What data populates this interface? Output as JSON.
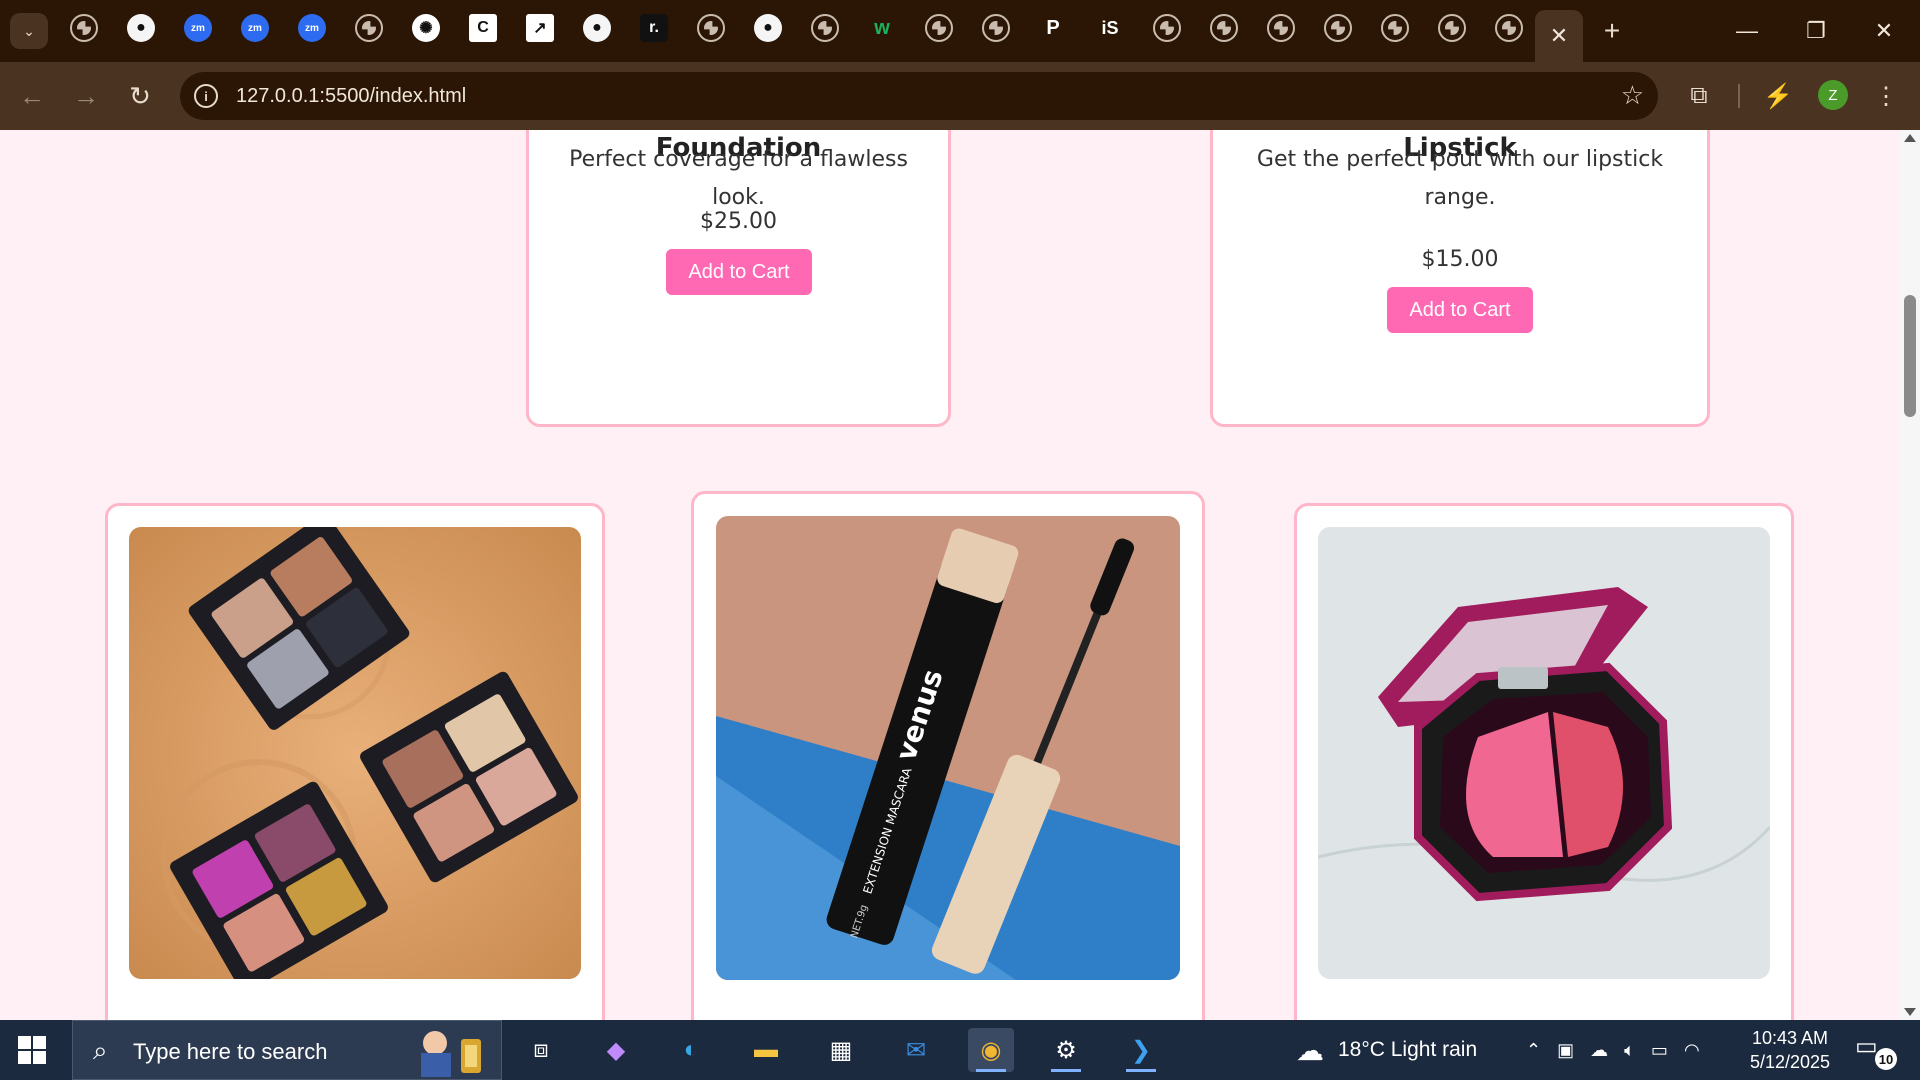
{
  "browser": {
    "tab_search_glyph": "⌄",
    "tabs": [
      {
        "icon": "globe-icon",
        "glyph": ""
      },
      {
        "icon": "github-icon",
        "glyph": "●"
      },
      {
        "icon": "zoom-icon",
        "glyph": "zm"
      },
      {
        "icon": "zoom-icon",
        "glyph": "zm"
      },
      {
        "icon": "zoom-icon",
        "glyph": "zm"
      },
      {
        "icon": "globe-icon",
        "glyph": ""
      },
      {
        "icon": "chatgpt-icon",
        "glyph": "✺"
      },
      {
        "icon": "c-logo-icon",
        "glyph": "C"
      },
      {
        "icon": "image-icon",
        "glyph": "↗"
      },
      {
        "icon": "github-icon",
        "glyph": "●"
      },
      {
        "icon": "r-logo-icon",
        "glyph": "r."
      },
      {
        "icon": "globe-icon",
        "glyph": ""
      },
      {
        "icon": "github-icon",
        "glyph": "●"
      },
      {
        "icon": "globe-icon",
        "glyph": ""
      },
      {
        "icon": "w-logo-icon",
        "glyph": "w"
      },
      {
        "icon": "globe-icon",
        "glyph": ""
      },
      {
        "icon": "globe-icon",
        "glyph": ""
      },
      {
        "icon": "p-logo-icon",
        "glyph": "P"
      },
      {
        "icon": "is-logo-icon",
        "glyph": "iS"
      },
      {
        "icon": "globe-icon",
        "glyph": ""
      },
      {
        "icon": "globe-icon",
        "glyph": ""
      },
      {
        "icon": "globe-icon",
        "glyph": ""
      },
      {
        "icon": "globe-icon",
        "glyph": ""
      },
      {
        "icon": "globe-icon",
        "glyph": ""
      },
      {
        "icon": "globe-icon",
        "glyph": ""
      },
      {
        "icon": "globe-icon",
        "glyph": ""
      }
    ],
    "active_tab_close": "✕",
    "new_tab": "+",
    "window_controls": {
      "minimize": "—",
      "restore": "❐",
      "close": "✕"
    },
    "url": "127.0.0.1:5500/index.html",
    "avatar_letter": "Z"
  },
  "page": {
    "top_cards": [
      {
        "title": "Foundation",
        "description": "Perfect coverage for a flawless look.",
        "price": "$25.00",
        "button": "Add to Cart"
      },
      {
        "title": "Lipstick",
        "description": "Get the perfect pout with our lipstick range.",
        "price": "$15.00",
        "button": "Add to Cart"
      }
    ],
    "bottom_cards": [
      {
        "image": "eyeshadow-palettes"
      },
      {
        "image": "mascara",
        "brand_text": "venus",
        "product_text": "EXTENSION MASCARA",
        "net": "NET.9g"
      },
      {
        "image": "blush-compact"
      }
    ],
    "colors": {
      "background": "#fff0f5",
      "card_border": "#ffb6c9",
      "button": "#ff69b4"
    }
  },
  "taskbar": {
    "search_placeholder": "Type here to search",
    "weather": "18°C  Light rain",
    "time": "10:43 AM",
    "date": "5/12/2025",
    "notifications": "10"
  }
}
